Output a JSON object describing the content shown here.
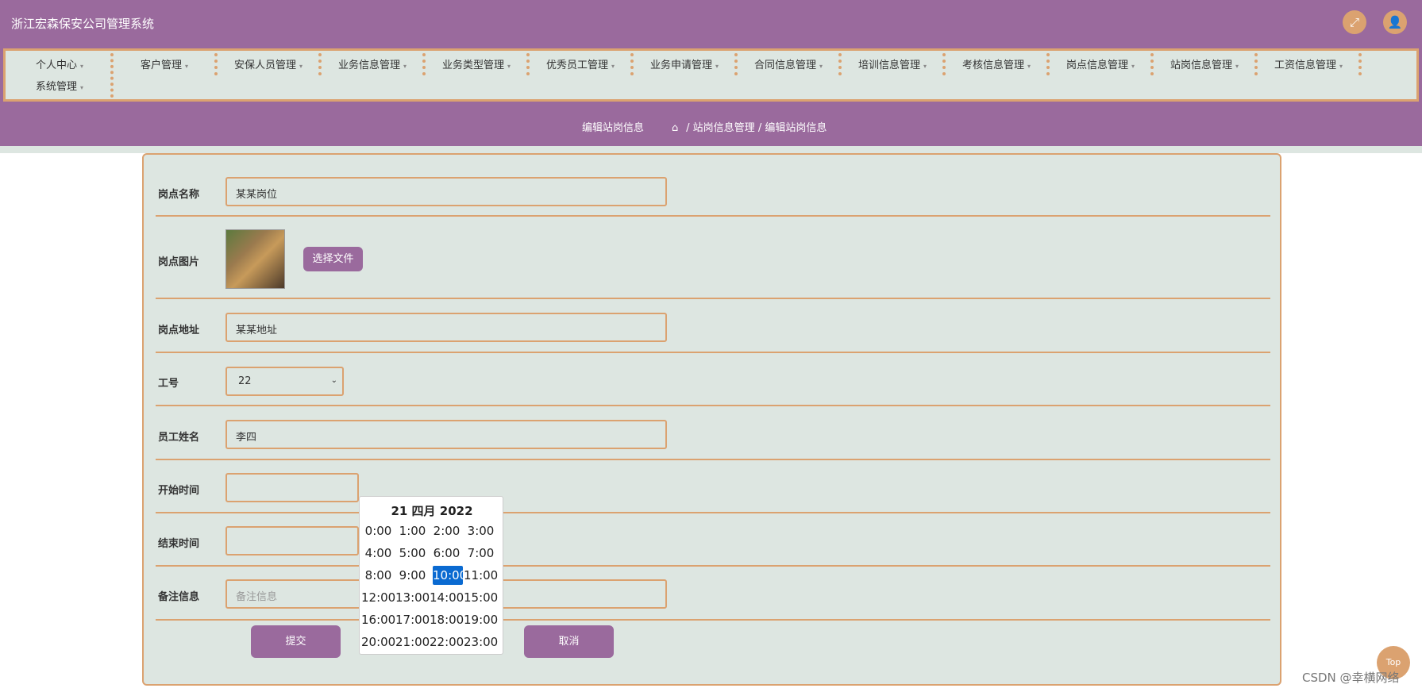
{
  "header": {
    "app_title": "浙江宏森保安公司管理系统"
  },
  "icons": {
    "fullscreen": "⤢",
    "user": "👤",
    "home": "⌂",
    "caret": "▾",
    "select_arrow": "⌄"
  },
  "nav": {
    "items": [
      "个人中心",
      "客户管理",
      "安保人员管理",
      "业务信息管理",
      "业务类型管理",
      "优秀员工管理",
      "业务申请管理",
      "合同信息管理",
      "培训信息管理",
      "考核信息管理",
      "岗点信息管理",
      "站岗信息管理",
      "工资信息管理",
      "系统管理"
    ]
  },
  "page": {
    "title": "编辑站岗信息",
    "breadcrumb": {
      "sep": "/",
      "parent": "站岗信息管理",
      "current": "编辑站岗信息"
    }
  },
  "form": {
    "post_name": {
      "label": "岗点名称",
      "value": "某某岗位"
    },
    "post_image": {
      "label": "岗点图片",
      "button": "选择文件"
    },
    "post_address": {
      "label": "岗点地址",
      "value": "某某地址"
    },
    "job_no": {
      "label": "工号",
      "value": "22"
    },
    "employee_name": {
      "label": "员工姓名",
      "value": "李四"
    },
    "start_time": {
      "label": "开始时间",
      "value": ""
    },
    "end_time": {
      "label": "结束时间",
      "value": ""
    },
    "remark": {
      "label": "备注信息",
      "placeholder": "备注信息"
    },
    "submit": "提交",
    "cancel": "取消"
  },
  "datepicker": {
    "title": "21 四月 2022",
    "hours": [
      "0:00",
      "1:00",
      "2:00",
      "3:00",
      "4:00",
      "5:00",
      "6:00",
      "7:00",
      "8:00",
      "9:00",
      "10:00",
      "11:00",
      "12:00",
      "13:00",
      "14:00",
      "15:00",
      "16:00",
      "17:00",
      "18:00",
      "19:00",
      "20:00",
      "21:00",
      "22:00",
      "23:00"
    ],
    "selected": "10:00"
  },
  "misc": {
    "top": "Top",
    "watermark": "CSDN @幸横网络"
  },
  "colors": {
    "primary": "#9a6a9d",
    "accent": "#dba270",
    "panel": "#dde6e1",
    "selected": "#0a6ad1"
  }
}
